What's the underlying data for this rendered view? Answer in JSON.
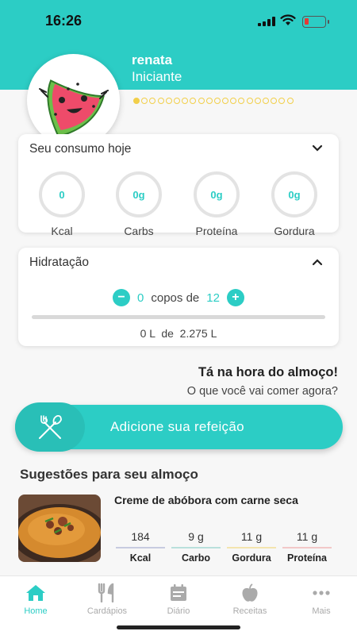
{
  "status": {
    "time": "16:26",
    "battery_level": 0.15
  },
  "profile": {
    "name": "renata",
    "level": "Iniciante",
    "progress_dots_total": 20,
    "progress_dots_filled": 1
  },
  "consumo": {
    "title": "Seu consumo hoje",
    "items": [
      {
        "value": "0",
        "label": "Kcal"
      },
      {
        "value": "0g",
        "label": "Carbs"
      },
      {
        "value": "0g",
        "label": "Proteína"
      },
      {
        "value": "0g",
        "label": "Gordura"
      }
    ]
  },
  "hidratacao": {
    "title": "Hidratação",
    "minus": "−",
    "plus": "+",
    "cups": "0",
    "copos_de": "copos de",
    "goal": "12",
    "liters": "0 L  de  2.275 L",
    "progress": 0
  },
  "meal": {
    "title": "Tá na hora do almoço!",
    "subtitle": "O que você vai comer agora?",
    "add_button": "Adicione sua refeição"
  },
  "suggestions": {
    "title": "Sugestões para seu almoço",
    "items": [
      {
        "name": "Creme de abóbora com carne seca",
        "nutrients": [
          {
            "value": "184",
            "label": "Kcal",
            "color": "#c7cbe0"
          },
          {
            "value": "9 g",
            "label": "Carbo",
            "color": "#b9e0dc"
          },
          {
            "value": "11 g",
            "label": "Gordura",
            "color": "#f3e4ae"
          },
          {
            "value": "11 g",
            "label": "Proteína",
            "color": "#f2c8c8"
          }
        ]
      }
    ]
  },
  "tabs": [
    {
      "label": "Home",
      "icon": "home-icon",
      "active": true
    },
    {
      "label": "Cardápios",
      "icon": "cutlery-icon",
      "active": false
    },
    {
      "label": "Diário",
      "icon": "calendar-icon",
      "active": false
    },
    {
      "label": "Receitas",
      "icon": "apple-icon",
      "active": false
    },
    {
      "label": "Mais",
      "icon": "more-icon",
      "active": false
    }
  ],
  "colors": {
    "accent": "#2ccdc5",
    "progress_dot": "#f2cf4a"
  }
}
